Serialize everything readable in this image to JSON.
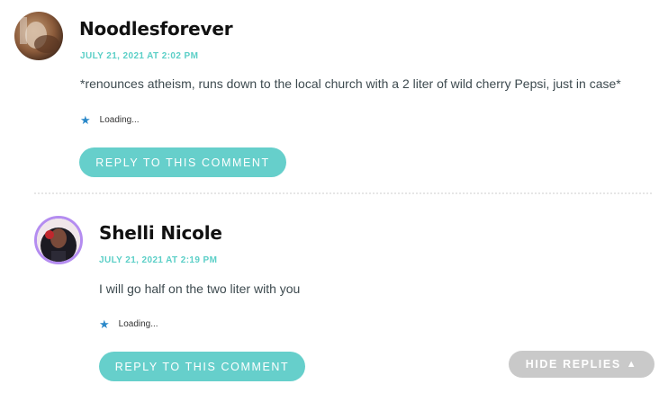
{
  "comments": [
    {
      "author": "Noodlesforever",
      "date": "JULY 21, 2021 AT 2:02 PM",
      "text": "*renounces atheism, runs down to the local church with a 2 liter of wild cherry Pepsi, just in case*",
      "like_status": "Loading...",
      "reply_label": "REPLY TO THIS COMMENT"
    },
    {
      "author": "Shelli Nicole",
      "date": "JULY 21, 2021 AT 2:19 PM",
      "text": "I will go half on the two liter with you",
      "like_status": "Loading...",
      "reply_label": "REPLY TO THIS COMMENT"
    }
  ],
  "hide_replies": {
    "label": "HIDE REPLIES",
    "icon": "triangle-up-icon"
  },
  "colors": {
    "accent": "#66cfcb",
    "date": "#5bcfc7",
    "hide_button": "#c9c9c9",
    "avatar_ring": "#b48cf0"
  }
}
